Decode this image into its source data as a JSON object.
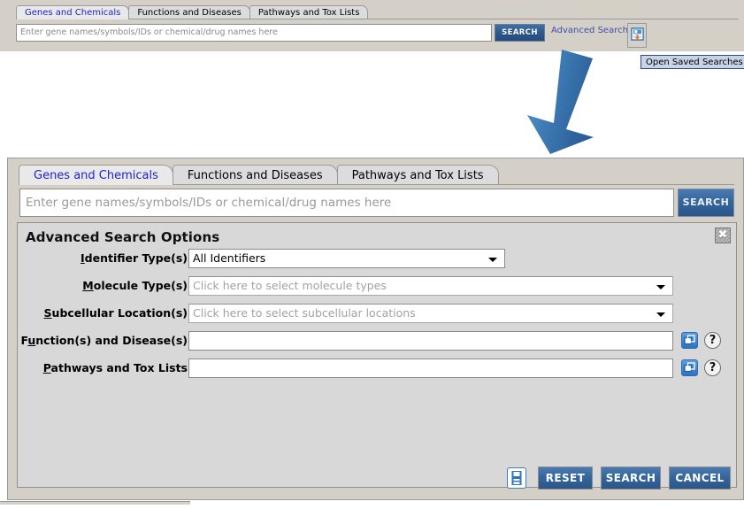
{
  "top_panel": {
    "tabs": [
      {
        "label": "Genes and Chemicals",
        "active": true
      },
      {
        "label": "Functions and Diseases",
        "active": false
      },
      {
        "label": "Pathways and Tox Lists",
        "active": false
      }
    ],
    "search_placeholder": "Enter gene names/symbols/IDs or chemical/drug names here",
    "search_value": "",
    "search_button": "SEARCH",
    "advanced_search_link": "Advanced Search",
    "saved_searches_icon": "save-upload-icon"
  },
  "tooltip": {
    "text": "Open Saved Searches"
  },
  "arrow": {
    "name": "down-left-arrow-annotation",
    "color": "#3a72ad"
  },
  "dialog": {
    "tabs": [
      {
        "label": "Genes and Chemicals",
        "active": true
      },
      {
        "label": "Functions and Diseases",
        "active": false
      },
      {
        "label": "Pathways and Tox Lists",
        "active": false
      }
    ],
    "search_placeholder": "Enter gene names/symbols/IDs or chemical/drug names here",
    "search_value": "",
    "search_button": "SEARCH",
    "options": {
      "title": "Advanced Search Options",
      "close_label": "✖",
      "rows": [
        {
          "label_pre": "",
          "label_mnemonic": "I",
          "label_post": "dentifier Type(s)",
          "value": "All Identifiers",
          "placeholder": "",
          "is_ghost": false,
          "has_caret": true,
          "control": "combobox"
        },
        {
          "label_pre": "",
          "label_mnemonic": "M",
          "label_post": "olecule Type(s)",
          "value": "",
          "placeholder": "Click here to select molecule types",
          "is_ghost": true,
          "has_caret": true,
          "control": "combobox"
        },
        {
          "label_pre": "",
          "label_mnemonic": "S",
          "label_post": "ubcellular Location(s)",
          "value": "",
          "placeholder": "Click here to select subcellular locations",
          "is_ghost": true,
          "has_caret": true,
          "control": "combobox"
        },
        {
          "label_pre": "F",
          "label_mnemonic": "u",
          "label_post": "nction(s) and Disease(s)",
          "value": "",
          "placeholder": "",
          "is_ghost": false,
          "has_caret": false,
          "control": "text-with-buttons"
        },
        {
          "label_pre": "",
          "label_mnemonic": "P",
          "label_post": "athways and Tox Lists",
          "value": "",
          "placeholder": "",
          "is_ghost": false,
          "has_caret": false,
          "control": "text-with-buttons"
        }
      ],
      "help_label": "?",
      "picker_icon": "open-window-icon"
    },
    "footer": {
      "save_icon": "floppy-disk-icon",
      "buttons": [
        {
          "label": "RESET"
        },
        {
          "label": "SEARCH"
        },
        {
          "label": "CANCEL"
        }
      ]
    }
  },
  "colors": {
    "accent_blue": "#2b5688",
    "link_blue": "#3b4fa8",
    "tab_active_text": "#2222cc",
    "panel_gray": "#d4d0c8",
    "options_gray": "#d8d8d8"
  }
}
